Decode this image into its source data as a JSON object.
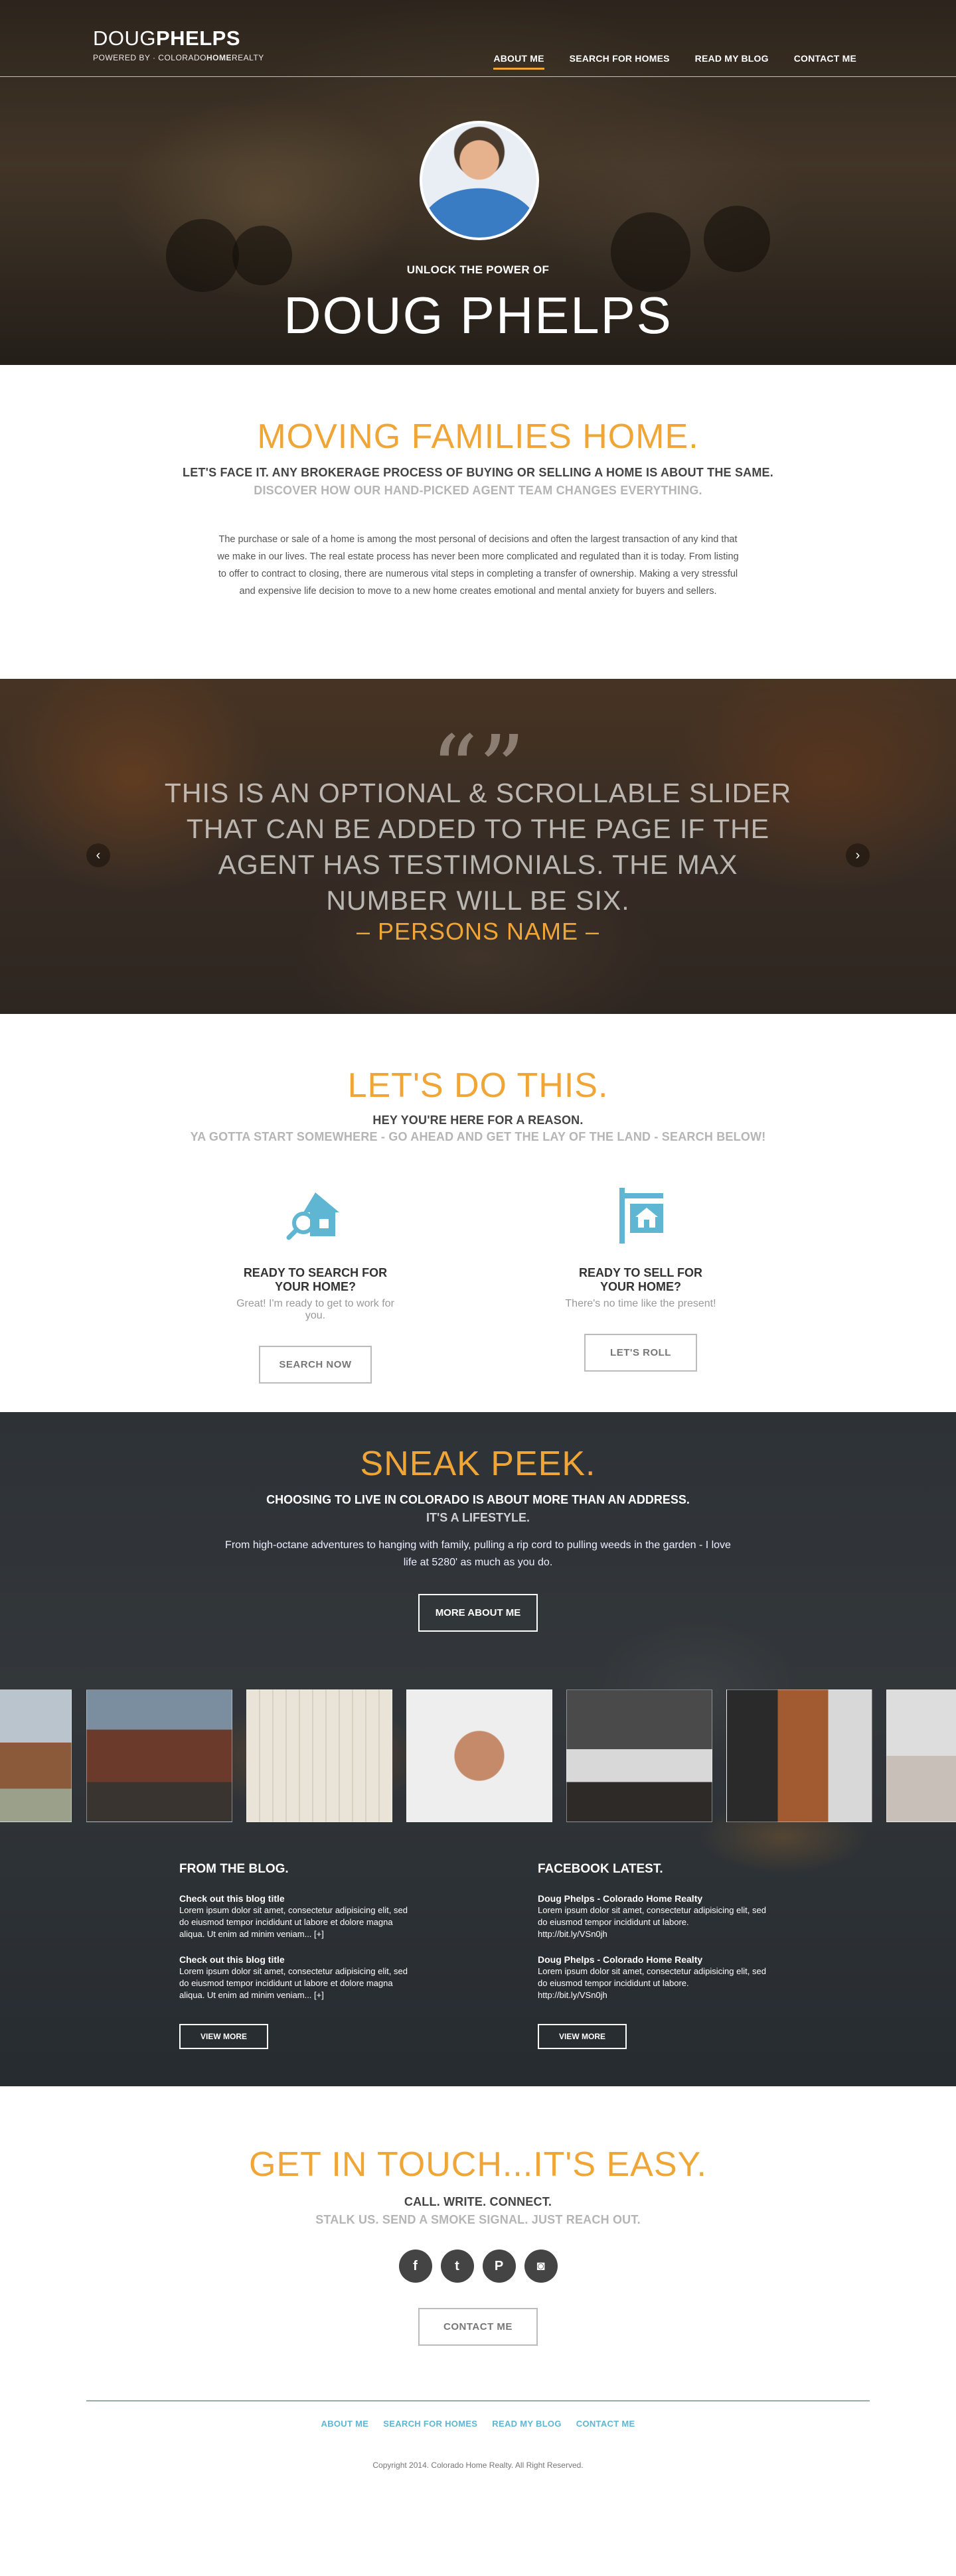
{
  "brand": {
    "name_light": "DOUG",
    "name_bold": "PHELPS",
    "powered_prefix": "POWERED BY · COLORADO",
    "powered_bold": "HOME",
    "powered_suffix": "REALTY"
  },
  "nav": {
    "items": [
      {
        "label": "ABOUT ME",
        "active": true
      },
      {
        "label": "SEARCH FOR HOMES"
      },
      {
        "label": "READ MY BLOG"
      },
      {
        "label": "CONTACT ME"
      }
    ]
  },
  "hero": {
    "tagline": "UNLOCK THE POWER OF",
    "name": "DOUG PHELPS"
  },
  "moving": {
    "title": "MOVING FAMILIES HOME.",
    "subtitle": "LET'S FACE IT. ANY BROKERAGE PROCESS OF BUYING OR SELLING A HOME IS ABOUT THE SAME.",
    "subtitle2": "DISCOVER HOW OUR HAND-PICKED AGENT TEAM CHANGES EVERYTHING.",
    "body": "The purchase or sale of a home is among the most personal of decisions and often the largest transaction of any kind that we make in our lives. The real estate process has never been more complicated and regulated than it is today. From listing to offer to contract to closing, there are numerous vital steps in completing a transfer of ownership. Making a very stressful and expensive life decision to move to a new home creates emotional and mental anxiety for buyers and sellers."
  },
  "testimonial": {
    "quote_mark": "“”",
    "text": "THIS IS AN OPTIONAL & SCROLLABLE SLIDER THAT CAN BE  ADDED TO THE PAGE IF THE AGENT HAS TESTIMONIALS. THE  MAX NUMBER WILL BE SIX.",
    "person": "– PERSONS NAME –",
    "prev": "‹",
    "next": "›"
  },
  "letsdo": {
    "title": "LET'S DO THIS.",
    "subtitle": "HEY YOU'RE HERE FOR A REASON.",
    "subtitle2": "YA GOTTA START SOMEWHERE - GO AHEAD AND GET THE LAY OF THE LAND - SEARCH BELOW!",
    "search": {
      "heading": "READY TO SEARCH FOR YOUR HOME?",
      "text": "Great! I'm ready to get to work for you.",
      "button": "SEARCH NOW",
      "icon": "search-home-icon"
    },
    "sell": {
      "heading": "READY TO SELL FOR YOUR HOME?",
      "text": "There's no time like the present!",
      "button": "LET'S ROLL",
      "icon": "sale-sign-icon"
    },
    "accent_color": "#5fb6d3"
  },
  "sneak": {
    "title": "SNEAK PEEK.",
    "line1": "CHOOSING TO LIVE IN COLORADO IS ABOUT MORE THAN AN ADDRESS.",
    "line2": "IT'S A LIFESTYLE.",
    "body": "From high-octane adventures to hanging with family, pulling a rip cord to pulling weeds in the garden - I love life at 5280' as much as you do.",
    "button": "MORE ABOUT ME"
  },
  "blog": {
    "heading": "FROM THE BLOG.",
    "entries": [
      {
        "title": "Check out this blog title",
        "text": "Lorem ipsum dolor sit amet, consectetur adipisicing elit, sed do eiusmod tempor incididunt ut labore et dolore magna aliqua. Ut enim ad minim veniam... [+]"
      },
      {
        "title": "Check out this blog title",
        "text": "Lorem ipsum dolor sit amet, consectetur adipisicing elit, sed do eiusmod tempor incididunt ut labore et dolore magna aliqua. Ut enim ad minim veniam... [+]"
      }
    ],
    "button": "VIEW MORE"
  },
  "facebook": {
    "heading": "FACEBOOK LATEST.",
    "entries": [
      {
        "title": "Doug Phelps - Colorado Home Realty",
        "text": "Lorem ipsum dolor sit amet, consectetur adipisicing elit, sed do eiusmod tempor incididunt ut labore.",
        "link": "http://bit.ly/VSn0jh"
      },
      {
        "title": "Doug Phelps - Colorado Home Realty",
        "text": "Lorem ipsum dolor sit amet, consectetur adipisicing elit, sed do eiusmod tempor incididunt ut labore.",
        "link": "http://bit.ly/VSn0jh"
      }
    ],
    "button": "VIEW MORE"
  },
  "contact": {
    "title": "GET IN TOUCH...IT'S EASY.",
    "subtitle": "CALL. WRITE. CONNECT.",
    "subtitle2": "STALK US. SEND A SMOKE SIGNAL. JUST REACH OUT.",
    "social": [
      {
        "icon": "facebook-icon",
        "glyph": "f"
      },
      {
        "icon": "twitter-icon",
        "glyph": "t"
      },
      {
        "icon": "pinterest-icon",
        "glyph": "P"
      },
      {
        "icon": "instagram-icon",
        "glyph": "◙"
      }
    ],
    "button": "CONTACT ME"
  },
  "footer": {
    "nav": [
      "ABOUT ME",
      "SEARCH FOR HOMES",
      "READ MY BLOG",
      "CONTACT ME"
    ],
    "copyright": "Copyright 2014. Colorado Home Realty. All Right Reserved."
  },
  "colors": {
    "accent": "#f0a537",
    "link": "#5fb6d3"
  }
}
